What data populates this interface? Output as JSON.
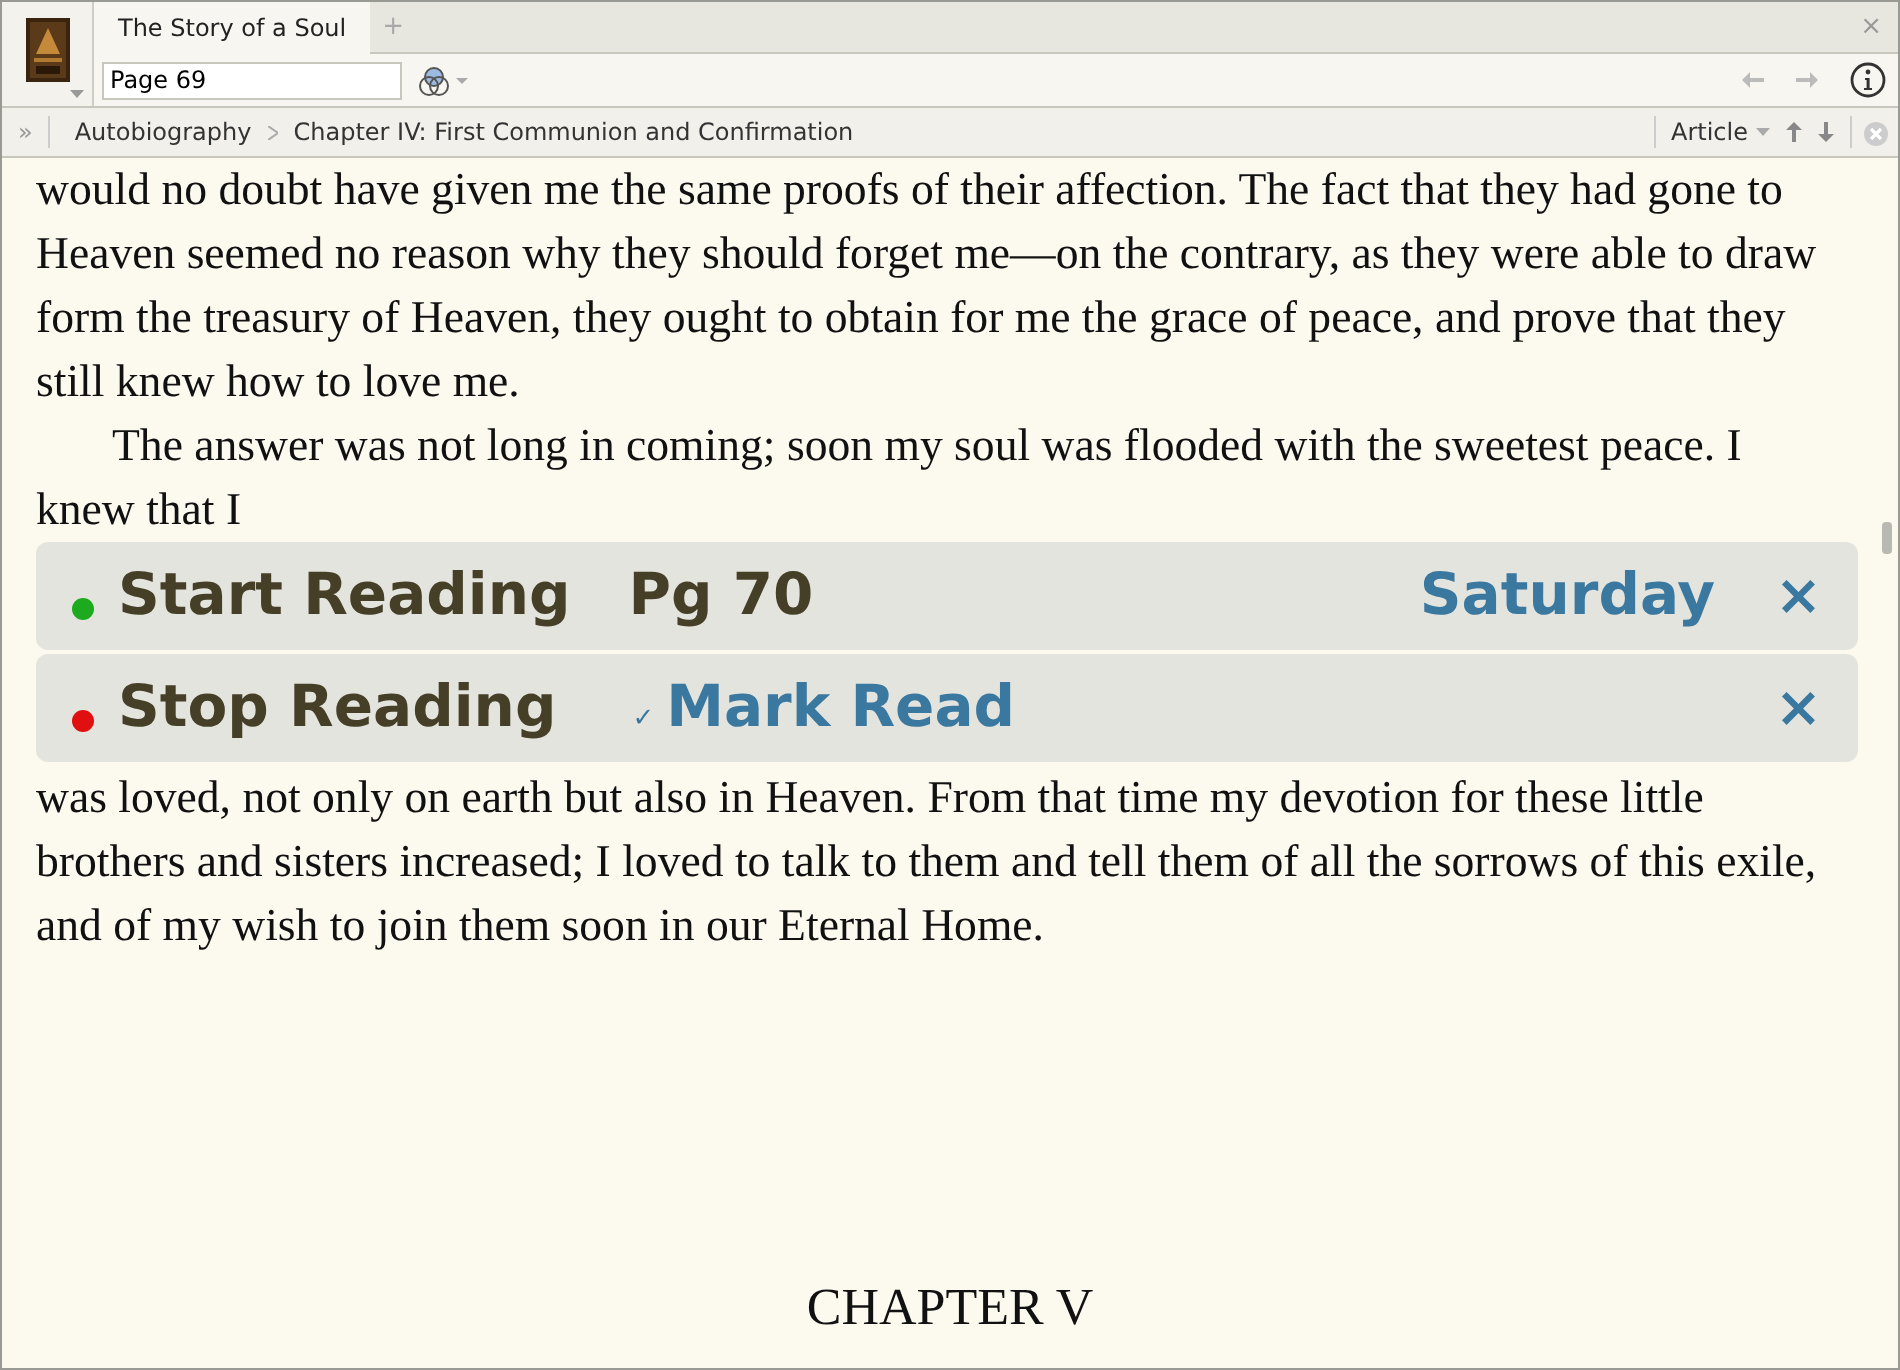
{
  "tabs": [
    {
      "label": "The Story of a Soul",
      "selected": true
    }
  ],
  "new_tab": "+",
  "close_tab": "×",
  "toolbar": {
    "page_field": "Page 69"
  },
  "breadcrumb": {
    "expand": "»",
    "items": [
      "Autobiography",
      "Chapter IV: First Communion and Confirmation"
    ],
    "view": "Article"
  },
  "paragraphs": [
    {
      "text": "would no doubt have given me the same proofs of their affection. The fact that they had gone to Heaven seemed no reason why they should forget me—on the contrary, as they were able to draw form the treasury of Heaven, they ought to obtain for me the grace of peace, and prove that they still knew how to love me.",
      "indent": false
    },
    {
      "text": "The answer was not long in coming; soon my soul was flooded with the sweetest peace. I knew that I",
      "indent": true
    }
  ],
  "reading_bars": [
    {
      "label": "Start Reading",
      "color": "#1eaa1e",
      "detail": "Pg 70",
      "action": "Saturday",
      "close": "×"
    },
    {
      "label": "Stop Reading",
      "color": "#e01010",
      "check": "✓",
      "action": "Mark Read",
      "close": "×"
    }
  ],
  "after_paragraphs": [
    {
      "text": "was loved, not only on earth but also in Heaven. From that time my devotion for these little brothers and sisters increased; I loved to talk to them and tell them of all the sorrows of this exile, and of my wish to join them soon in our Eternal Home.",
      "indent": false
    }
  ],
  "heading": "CHAPTER V"
}
